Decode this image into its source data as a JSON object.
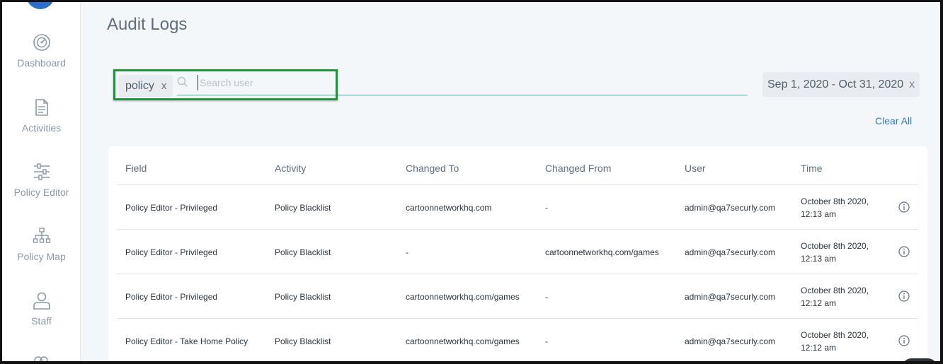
{
  "page": {
    "title": "Audit Logs"
  },
  "sidebar": {
    "items": [
      {
        "label": "Dashboard",
        "icon": "gauge-icon"
      },
      {
        "label": "Activities",
        "icon": "document-icon"
      },
      {
        "label": "Policy Editor",
        "icon": "sliders-icon"
      },
      {
        "label": "Policy Map",
        "icon": "sitemap-icon"
      },
      {
        "label": "Staff",
        "icon": "user-icon"
      }
    ]
  },
  "filters": {
    "chip_label": "policy",
    "chip_remove": "x",
    "search_placeholder": "Search user",
    "date_range": "Sep 1, 2020 - Oct 31, 2020",
    "date_remove": "x",
    "clear_all": "Clear All"
  },
  "colors": {
    "accent": "#2d79c7",
    "underline": "#48b39b",
    "highlight": "#23913f"
  },
  "table": {
    "columns": [
      "Field",
      "Activity",
      "Changed To",
      "Changed From",
      "User",
      "Time"
    ],
    "rows": [
      {
        "field": "Policy Editor - Privileged",
        "activity": "Policy Blacklist",
        "changed_to": "cartoonnetworkhq.com",
        "changed_from": "-",
        "user": "admin@qa7securly.com",
        "time_date": "October 8th 2020,",
        "time_clock": "12:13 am"
      },
      {
        "field": "Policy Editor - Privileged",
        "activity": "Policy Blacklist",
        "changed_to": "-",
        "changed_from": "cartoonnetworkhq.com/games",
        "user": "admin@qa7securly.com",
        "time_date": "October 8th 2020,",
        "time_clock": "12:13 am"
      },
      {
        "field": "Policy Editor - Privileged",
        "activity": "Policy Blacklist",
        "changed_to": "cartoonnetworkhq.com/games",
        "changed_from": "-",
        "user": "admin@qa7securly.com",
        "time_date": "October 8th 2020,",
        "time_clock": "12:12 am"
      },
      {
        "field": "Policy Editor - Take Home Policy",
        "activity": "Policy Blacklist",
        "changed_to": "cartoonnetworkhq.com/games",
        "changed_from": "-",
        "user": "admin@qa7securly.com",
        "time_date": "October 8th 2020,",
        "time_clock": "12:12 am"
      }
    ]
  }
}
